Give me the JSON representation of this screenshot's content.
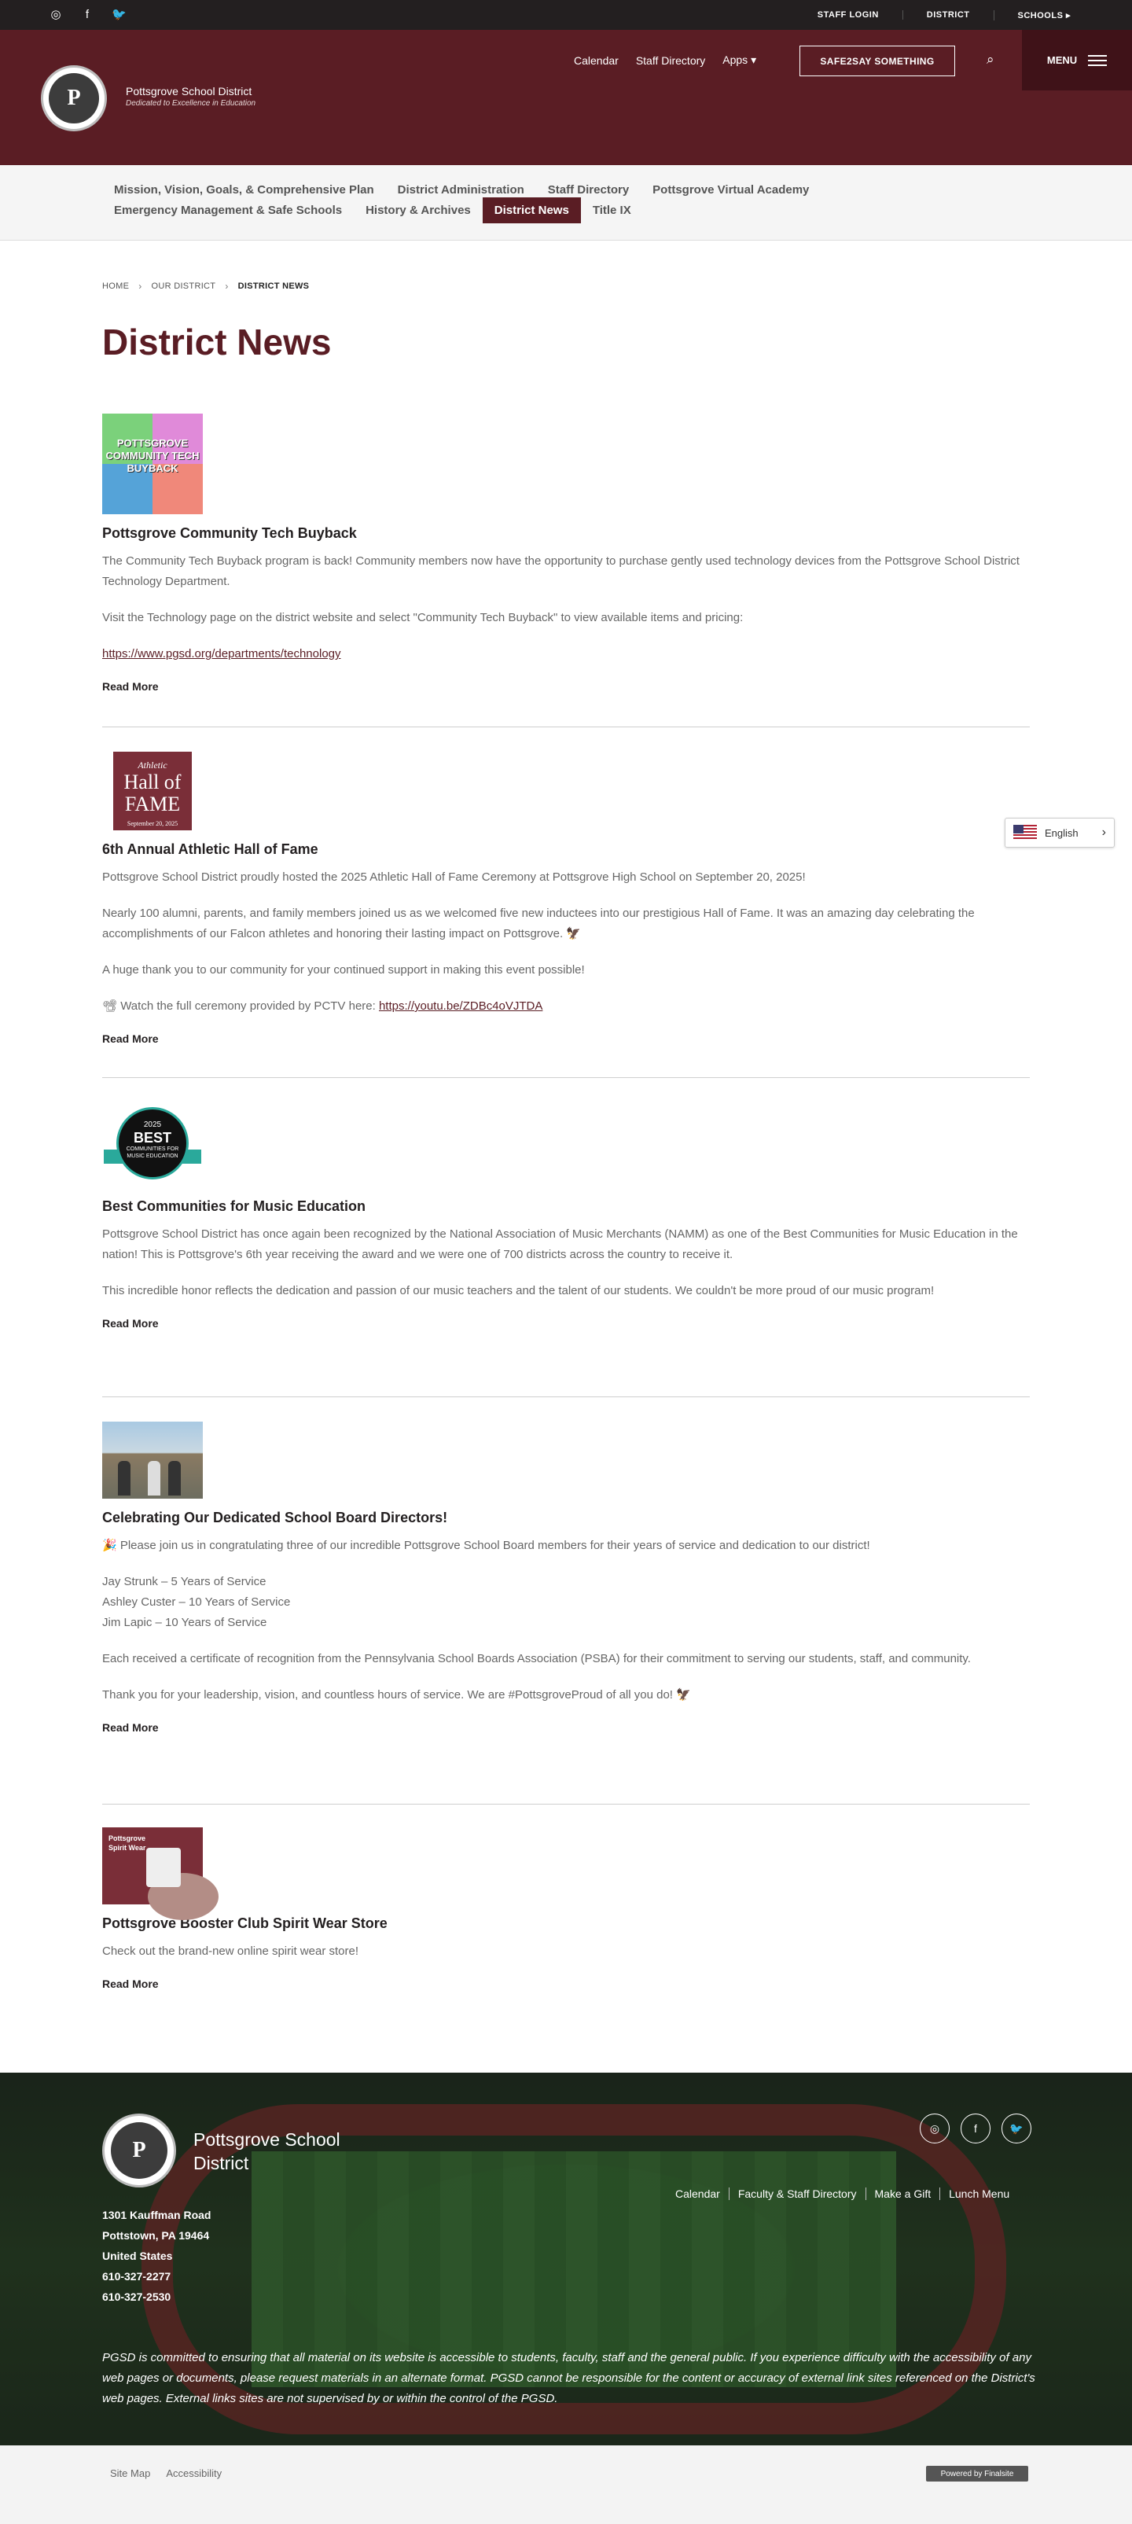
{
  "topbar": {
    "social": [
      "instagram-icon",
      "facebook-icon",
      "twitter-icon"
    ],
    "links": [
      "STAFF LOGIN",
      "DISTRICT",
      "SCHOOLS ▸"
    ]
  },
  "header": {
    "school_name": "Pottsgrove School District",
    "tagline": "Dedicated to Excellence in Education",
    "nav": [
      "Calendar",
      "Staff Directory",
      "Apps ▾"
    ],
    "safe_button": "SAFE2SAY SOMETHING",
    "menu_label": "MENU",
    "brand_color": "#5a1d24"
  },
  "subnav": {
    "row1": [
      "Mission, Vision, Goals, & Comprehensive Plan",
      "District Administration",
      "Staff Directory",
      "Pottsgrove Virtual Academy"
    ],
    "row2": [
      "Emergency Management & Safe Schools",
      "History & Archives",
      "District News",
      "Title IX"
    ],
    "active": "District News"
  },
  "breadcrumb": [
    "HOME",
    "OUR DISTRICT",
    "DISTRICT NEWS"
  ],
  "page_title": "District News",
  "news": [
    {
      "title": "Pottsgrove Community Tech Buyback",
      "thumb_text": "POTTSGROVE COMMUNITY TECH BUYBACK",
      "p1": "The Community Tech Buyback program is back! Community members now have the opportunity to purchase gently used technology devices from the Pottsgrove School District Technology Department.",
      "p2": "Visit the Technology page on the district website and select \"Community Tech Buyback\" to view available items and pricing:",
      "link": "https://www.pgsd.org/departments/technology",
      "read_more": "Read More"
    },
    {
      "title": "6th Annual Athletic Hall of Fame",
      "thumb_a": "Athletic",
      "thumb_b": "Hall of FAME",
      "thumb_c": "September 20, 2025",
      "p1": "Pottsgrove School District proudly hosted the 2025 Athletic Hall of Fame Ceremony at Pottsgrove High School on September 20, 2025!",
      "p2": "Nearly 100 alumni, parents, and family members joined us as we welcomed five new inductees into our prestigious Hall of Fame. It was an amazing day celebrating the accomplishments of our Falcon athletes and honoring their lasting impact on Pottsgrove. 🦅",
      "p3": "A huge thank you to our community for your continued support in making this event possible!",
      "p4_prefix": "📽 Watch the full ceremony provided by PCTV here: ",
      "link": "https://youtu.be/ZDBc4oVJTDA",
      "read_more": "Read More"
    },
    {
      "title": "Best Communities for Music Education",
      "thumb_year": "2025",
      "thumb_best": "BEST",
      "thumb_sub": "COMMUNITIES FOR MUSIC EDUCATION",
      "p1": "Pottsgrove School District has once again been recognized by the National Association of Music Merchants (NAMM) as one of the Best Communities for Music Education in the nation! This is Pottsgrove's 6th year receiving the award and we were one of 700 districts across the country to receive it.",
      "p2": "This incredible honor reflects the dedication and passion of our music teachers and the talent of our students. We couldn't be more proud of our music program!",
      "read_more": "Read More"
    },
    {
      "title": "Celebrating Our Dedicated School Board Directors!",
      "p1": "🎉 Please join us in congratulating three of our incredible Pottsgrove School Board members for their years of service and dedication to our district!",
      "list": [
        "Jay Strunk – 5 Years of Service",
        "Ashley Custer – 10 Years of Service",
        "Jim Lapic – 10 Years of Service"
      ],
      "p2": "Each received a certificate of recognition from the Pennsylvania School Boards Association (PSBA) for their commitment to serving our students, staff, and community.",
      "p3": "Thank you for your leadership, vision, and countless hours of service. We are #PottsgroveProud of all you do! 🦅",
      "read_more": "Read More"
    },
    {
      "title": "Pottsgrove Booster Club Spirit Wear Store",
      "thumb_text": "Pottsgrove Spirit Wear",
      "p1": "Check out the brand-new online spirit wear store!",
      "read_more": "Read More"
    }
  ],
  "translate": {
    "language": "English"
  },
  "footer": {
    "name": "Pottsgrove School District",
    "address": [
      "1301 Kauffman Road",
      "Pottstown, PA  19464",
      "United States"
    ],
    "phones": [
      "610-327-2277",
      "610-327-2530"
    ],
    "social": [
      "instagram-icon",
      "facebook-icon",
      "twitter-icon"
    ],
    "links": [
      "Calendar",
      "Faculty & Staff Directory",
      "Make a Gift",
      "Lunch Menu"
    ],
    "note": "PGSD is committed to ensuring that all material on its website is accessible to students, faculty, staff and the general public. If you experience difficulty with the accessibility of any web pages or documents, please request materials in an alternate format. PGSD cannot be responsible for the content or accuracy of external link sites referenced on the District's web pages. External links sites are not supervised by or within the control of the PGSD."
  },
  "bottom": {
    "links": [
      "Site Map",
      "Accessibility"
    ],
    "powered": "Powered by Finalsite"
  }
}
